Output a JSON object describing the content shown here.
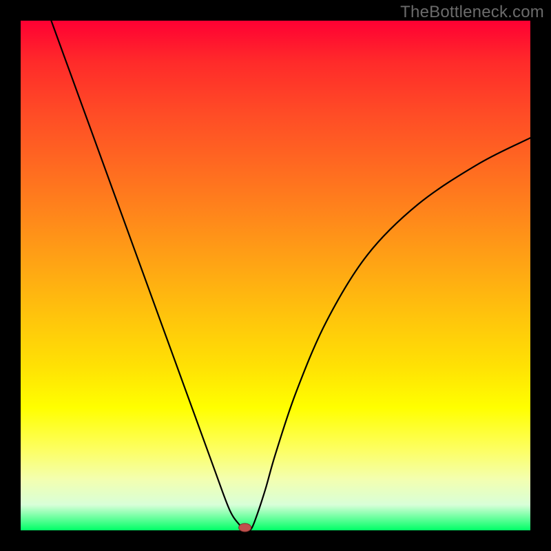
{
  "watermark": "TheBottleneck.com",
  "chart_data": {
    "type": "line",
    "title": "",
    "xlabel": "",
    "ylabel": "",
    "xlim": [
      0,
      100
    ],
    "ylim": [
      0,
      100
    ],
    "series": [
      {
        "name": "bottleneck-curve",
        "x": [
          6,
          10,
          14,
          18,
          22,
          26,
          30,
          34,
          38,
          41,
          43,
          44,
          45,
          46,
          48,
          50,
          54,
          60,
          68,
          78,
          90,
          100
        ],
        "y": [
          100,
          89,
          78,
          67,
          56,
          45,
          34,
          23,
          12,
          4,
          1,
          0,
          0,
          2,
          8,
          15,
          27,
          41,
          54,
          64,
          72,
          77
        ]
      }
    ],
    "marker": {
      "name": "optimum-point",
      "x": 44,
      "y": 0,
      "color": "#c0504d"
    },
    "gradient_stops": [
      {
        "pct": 0,
        "color": "#ff0033"
      },
      {
        "pct": 50,
        "color": "#ffc400"
      },
      {
        "pct": 76,
        "color": "#ffff00"
      },
      {
        "pct": 100,
        "color": "#00ff66"
      }
    ]
  }
}
